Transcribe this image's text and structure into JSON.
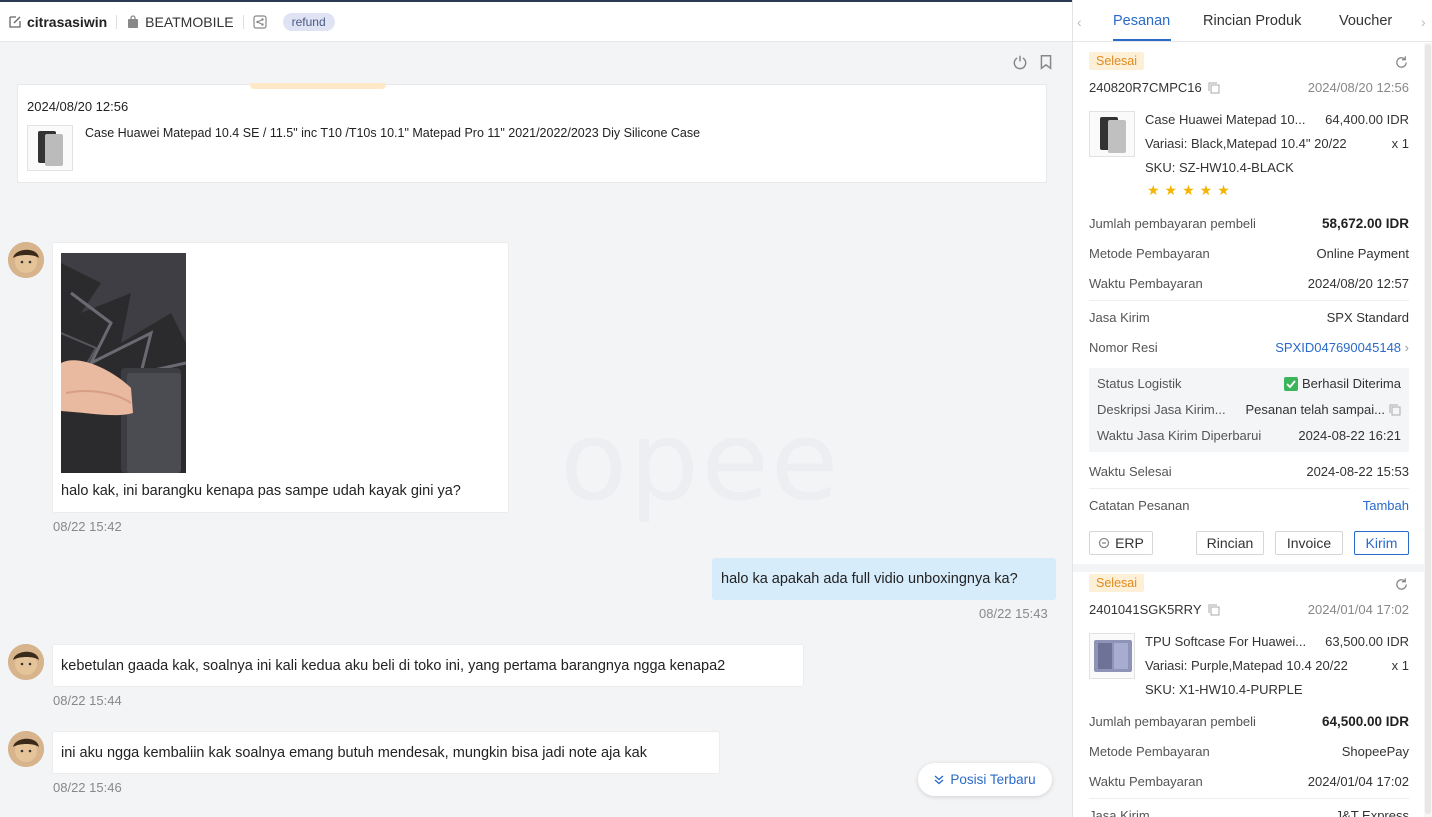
{
  "header": {
    "user": "citrasasiwin",
    "shop": "BEATMOBILE",
    "tag": "refund"
  },
  "watermark": "opee",
  "product_card": {
    "date": "2024/08/20 12:56",
    "name": "Case Huawei Matepad 10.4 SE / 11.5\" inc T10 /T10s 10.1\" Matepad Pro 11\" 2021/2022/2023 Diy Silicone Case"
  },
  "messages": [
    {
      "text": "halo kak, ini barangku kenapa pas sampe udah kayak gini ya?",
      "time": "08/22 15:42"
    },
    {
      "text": "halo ka apakah ada full vidio unboxingnya ka?",
      "time": "08/22 15:43"
    },
    {
      "text": "kebetulan gaada kak, soalnya ini kali kedua aku beli di toko ini, yang pertama barangnya ngga kenapa2",
      "time": "08/22 15:44"
    },
    {
      "text": "ini aku ngga kembaliin kak soalnya emang butuh mendesak, mungkin bisa jadi note aja kak",
      "time": "08/22 15:46"
    }
  ],
  "latest_button": "Posisi Terbaru",
  "tabs": [
    "Pesanan",
    "Rincian Produk",
    "Voucher"
  ],
  "orders": [
    {
      "status": "Selesai",
      "id": "240820R7CMPC16",
      "date": "2024/08/20 12:56",
      "product_name": "Case Huawei Matepad 10...",
      "price": "64,400.00 IDR",
      "variant": "Variasi:  Black,Matepad 10.4\" 20/22",
      "qty": "x 1",
      "sku": "SKU:  SZ-HW10.4-BLACK",
      "stars": "★★★★★",
      "rows": [
        {
          "label": "Jumlah pembayaran pembeli",
          "value": "58,672.00 IDR"
        },
        {
          "label": "Metode Pembayaran",
          "value": "Online Payment"
        },
        {
          "label": "Waktu Pembayaran",
          "value": "2024/08/20 12:57"
        },
        {
          "label": "Jasa Kirim",
          "value": "SPX Standard"
        },
        {
          "label": "Nomor Resi",
          "value": "SPXID047690045148"
        }
      ],
      "logistics": [
        {
          "label": "Status Logistik",
          "value": "Berhasil Diterima"
        },
        {
          "label": "Deskripsi Jasa Kirim...",
          "value": "Pesanan telah sampai..."
        },
        {
          "label": "Waktu Jasa Kirim Diperbarui",
          "value": "2024-08-22 16:21"
        }
      ],
      "finish_label": "Waktu Selesai",
      "finish_value": "2024-08-22 15:53",
      "note_label": "Catatan Pesanan",
      "note_action": "Tambah",
      "buttons": {
        "erp": "ERP",
        "detail": "Rincian",
        "invoice": "Invoice",
        "send": "Kirim"
      }
    },
    {
      "status": "Selesai",
      "id": "2401041SGK5RRY",
      "date": "2024/01/04 17:02",
      "product_name": "TPU Softcase For Huawei...",
      "price": "63,500.00 IDR",
      "variant": "Variasi:  Purple,Matepad 10.4 20/22",
      "qty": "x 1",
      "sku": "SKU:  X1-HW10.4-PURPLE",
      "rows": [
        {
          "label": "Jumlah pembayaran pembeli",
          "value": "64,500.00 IDR"
        },
        {
          "label": "Metode Pembayaran",
          "value": "ShopeePay"
        },
        {
          "label": "Waktu Pembayaran",
          "value": "2024/01/04 17:02"
        },
        {
          "label": "Jasa Kirim",
          "value": "J&T Express"
        }
      ]
    }
  ]
}
